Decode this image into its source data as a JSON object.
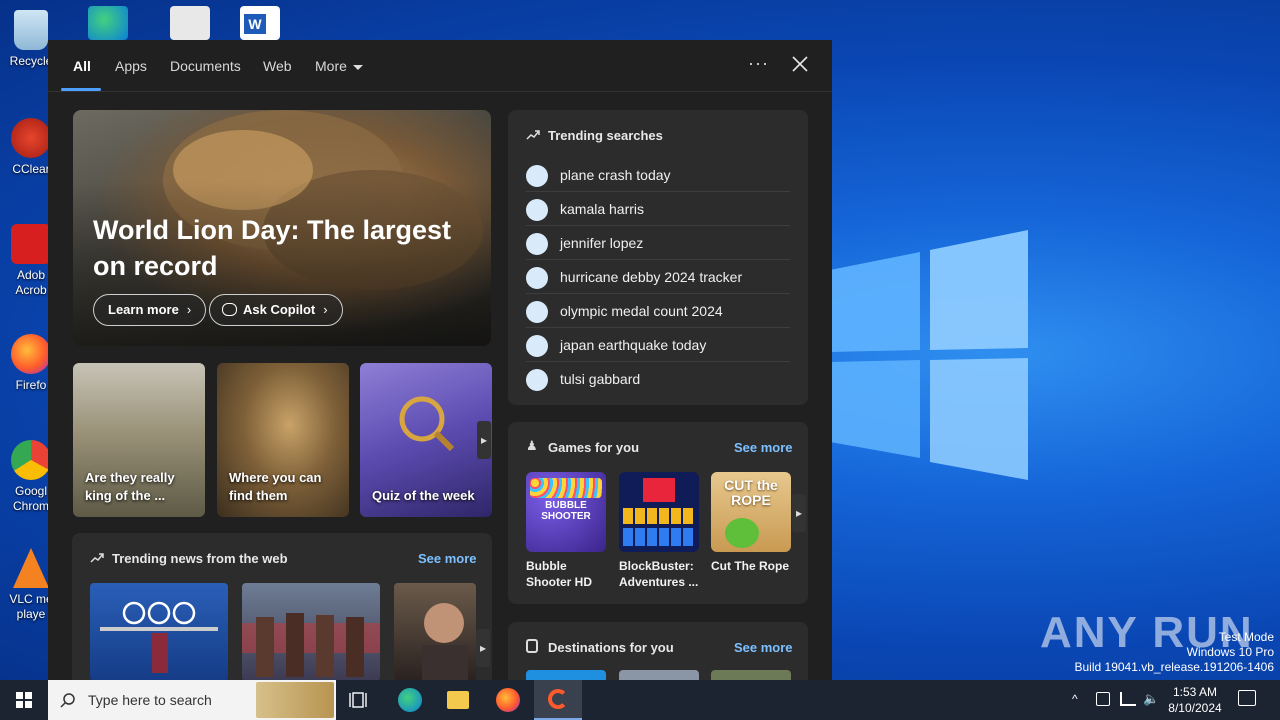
{
  "desktop": {
    "icons": [
      {
        "label": "Recycle"
      },
      {
        "label": "CClear"
      },
      {
        "label": "Adob Acrob"
      },
      {
        "label": "Firefo"
      },
      {
        "label": "Googl Chrom"
      },
      {
        "label": "VLC me playe"
      }
    ],
    "watermark": "ANY RUN",
    "test_mode": [
      "Test Mode",
      "Windows 10 Pro",
      "Build 19041.vb_release.191206-1406"
    ]
  },
  "search": {
    "tabs": [
      "All",
      "Apps",
      "Documents",
      "Web",
      "More"
    ],
    "active_tab": "All",
    "more_label": "···",
    "hero": {
      "title": "World Lion Day: The largest on record",
      "learn_more": "Learn more",
      "ask_copilot": "Ask Copilot"
    },
    "tiles": [
      {
        "label": "Are they really king of the ..."
      },
      {
        "label": "Where you can find them"
      },
      {
        "label": "Quiz of the week"
      }
    ],
    "trending": {
      "title": "Trending searches",
      "items": [
        "plane crash today",
        "kamala harris",
        "jennifer lopez",
        "hurricane debby 2024 tracker",
        "olympic medal count 2024",
        "japan earthquake today",
        "tulsi gabbard"
      ]
    },
    "games": {
      "title": "Games for you",
      "see_more": "See more",
      "items": [
        {
          "name": "Bubble Shooter HD",
          "art": "BUBBLE SHOOTER"
        },
        {
          "name": "BlockBuster: Adventures ...",
          "art": ""
        },
        {
          "name": "Cut The Rope",
          "art": "CUT the ROPE"
        }
      ]
    },
    "news": {
      "title": "Trending news from the web",
      "see_more": "See more"
    },
    "destinations": {
      "title": "Destinations for you",
      "see_more": "See more"
    }
  },
  "taskbar": {
    "search_placeholder": "Type here to search",
    "time": "1:53 AM",
    "date": "8/10/2024"
  },
  "colors": {
    "accent": "#4ca0ff",
    "link": "#7cc0ff",
    "panel_bg": "#202020",
    "card_bg": "#2c2c2c"
  }
}
